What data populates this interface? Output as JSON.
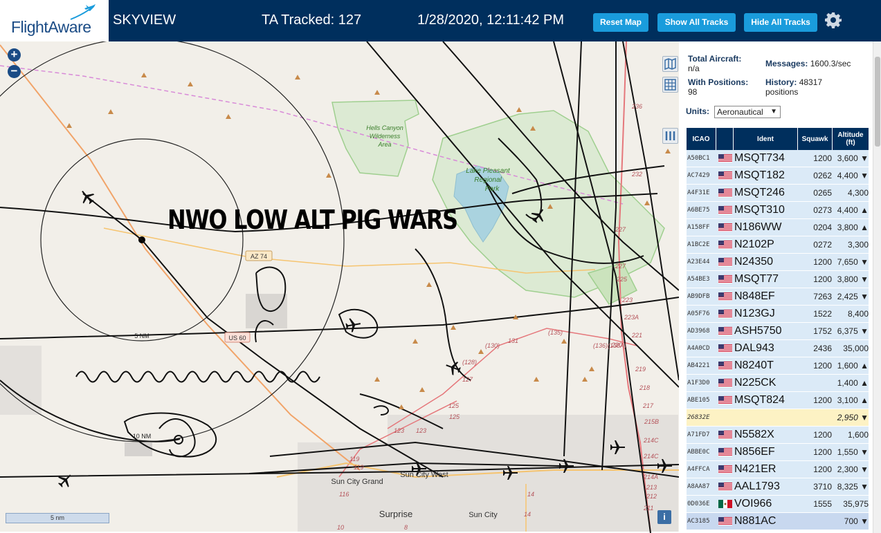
{
  "header": {
    "logo": "FlightAware",
    "app_title": "SKYVIEW",
    "tracked": "TA Tracked: 127",
    "datetime": "1/28/2020, 12:11:42 PM",
    "buttons": {
      "reset_map": "Reset Map",
      "show_all": "Show All Tracks",
      "hide_all": "Hide All Tracks"
    }
  },
  "map": {
    "overlay_title": "NWO LOW ALT PIG WARS",
    "scale": "5 nm",
    "labels": {
      "hells_canyon": [
        "Hells Canyon",
        "Wilderness",
        "Area"
      ],
      "lake_pleasant": [
        "Lake Pleasant",
        "Regional",
        "Park"
      ],
      "az74": "AZ 74",
      "us60": "US 60",
      "ring_5nm": "5 NM",
      "ring_10nm": "10 NM",
      "sun_city_grand": "Sun City Grand",
      "sun_city_west": "Sun City West",
      "surprise": "Surprise",
      "sun_city": "Sun City"
    },
    "road_numbers": [
      "236",
      "232",
      "227",
      "227",
      "225",
      "223",
      "223A",
      "221",
      "220",
      "219",
      "218",
      "217",
      "215B",
      "214C",
      "214C",
      "214A",
      "213",
      "212",
      "211",
      "131",
      "(135)",
      "(130)",
      "(136)",
      "(138A)",
      "(128)",
      "127",
      "125",
      "125",
      "123",
      "123",
      "119",
      "119",
      "116",
      "14",
      "14",
      "10",
      "8"
    ]
  },
  "panel": {
    "total_aircraft_label": "Total Aircraft:",
    "total_aircraft_value": "n/a",
    "messages_label": "Messages:",
    "messages_value": "1600.3/sec",
    "with_positions_label": "With Positions:",
    "with_positions_value": "98",
    "history_label": "History:",
    "history_value": "48317 positions",
    "units_label": "Units:",
    "units_value": "Aeronautical",
    "columns": {
      "icao": "ICAO",
      "ident": "Ident",
      "squawk": "Squawk",
      "altitude": "Altitude (ft)"
    },
    "rows": [
      {
        "icao": "A50BC1",
        "flag": "us",
        "ident": "MSQT734",
        "squawk": "1200",
        "alt": "3,600 ▼"
      },
      {
        "icao": "AC7429",
        "flag": "us",
        "ident": "MSQT182",
        "squawk": "0262",
        "alt": "4,400 ▼"
      },
      {
        "icao": "A4F31E",
        "flag": "us",
        "ident": "MSQT246",
        "squawk": "0265",
        "alt": "4,300"
      },
      {
        "icao": "A6BE75",
        "flag": "us",
        "ident": "MSQT310",
        "squawk": "0273",
        "alt": "4,400 ▲"
      },
      {
        "icao": "A158FF",
        "flag": "us",
        "ident": "N186WW",
        "squawk": "0204",
        "alt": "3,800 ▲"
      },
      {
        "icao": "A1BC2E",
        "flag": "us",
        "ident": "N2102P",
        "squawk": "0272",
        "alt": "3,300"
      },
      {
        "icao": "A23E44",
        "flag": "us",
        "ident": "N24350",
        "squawk": "1200",
        "alt": "7,650 ▼"
      },
      {
        "icao": "A54BE3",
        "flag": "us",
        "ident": "MSQT77",
        "squawk": "1200",
        "alt": "3,800 ▼"
      },
      {
        "icao": "AB9DFB",
        "flag": "us",
        "ident": "N848EF",
        "squawk": "7263",
        "alt": "2,425 ▼"
      },
      {
        "icao": "A05F76",
        "flag": "us",
        "ident": "N123GJ",
        "squawk": "1522",
        "alt": "8,400"
      },
      {
        "icao": "AD3968",
        "flag": "us",
        "ident": "ASH5750",
        "squawk": "1752",
        "alt": "6,375 ▼"
      },
      {
        "icao": "A4A0CD",
        "flag": "us",
        "ident": "DAL943",
        "squawk": "2436",
        "alt": "35,000"
      },
      {
        "icao": "AB4221",
        "flag": "us",
        "ident": "N8240T",
        "squawk": "1200",
        "alt": "1,600 ▲"
      },
      {
        "icao": "A1F3D0",
        "flag": "us",
        "ident": "N225CK",
        "squawk": "",
        "alt": "1,400 ▲"
      },
      {
        "icao": "ABE105",
        "flag": "us",
        "ident": "MSQT824",
        "squawk": "1200",
        "alt": "3,100 ▲"
      },
      {
        "icao": "26832E",
        "flag": "",
        "ident": "",
        "squawk": "",
        "alt": "2,950 ▼"
      },
      {
        "icao": "A71FD7",
        "flag": "us",
        "ident": "N5582X",
        "squawk": "1200",
        "alt": "1,600"
      },
      {
        "icao": "ABBE0C",
        "flag": "us",
        "ident": "N856EF",
        "squawk": "1200",
        "alt": "1,550 ▼"
      },
      {
        "icao": "A4FFCA",
        "flag": "us",
        "ident": "N421ER",
        "squawk": "1200",
        "alt": "2,300 ▼"
      },
      {
        "icao": "A8AA87",
        "flag": "us",
        "ident": "AAL1793",
        "squawk": "3710",
        "alt": "8,325 ▼"
      },
      {
        "icao": "0D036E",
        "flag": "mx",
        "ident": "VOI966",
        "squawk": "1555",
        "alt": "35,975"
      },
      {
        "icao": "AC3185",
        "flag": "us",
        "ident": "N881AC",
        "squawk": "",
        "alt": "700 ▼"
      }
    ]
  },
  "colors": {
    "header_bg": "#002f5d",
    "button": "#1a9cdc",
    "row_alt": "#dbeaf7",
    "row_highlight": "#fdf2c4"
  }
}
